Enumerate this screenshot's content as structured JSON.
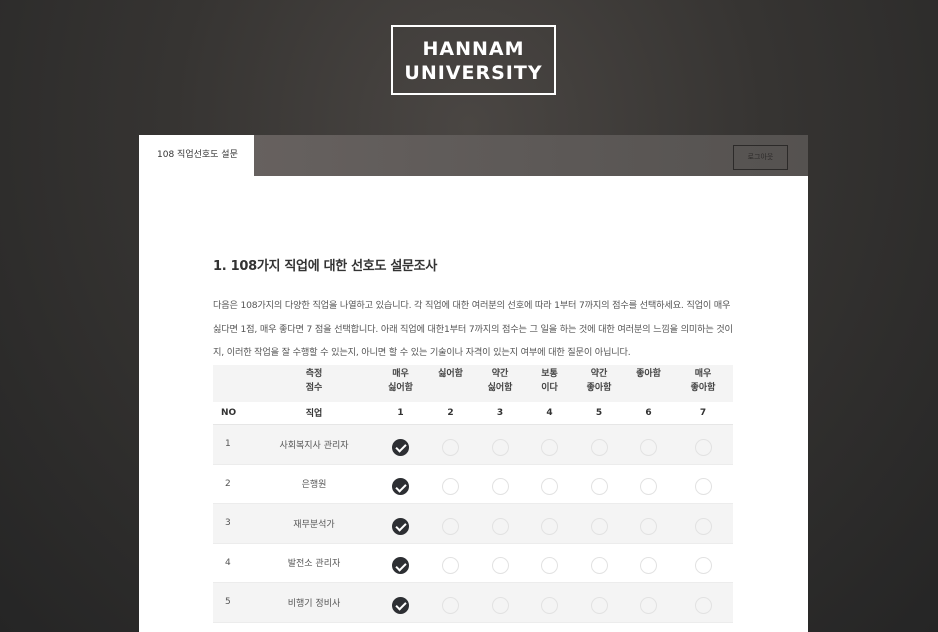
{
  "logo": {
    "line1": "HANNAM",
    "line2": "UNIVERSITY"
  },
  "header": {
    "tab_label": "108 직업선호도 설문",
    "logout_label": "로그아웃"
  },
  "section": {
    "title": "1. 108가지 직업에 대한 선호도 설문조사",
    "description": "다음은 108가지의 다양한 직업을 나열하고 있습니다. 각 직업에 대한 여러분의 선호에 따라 1부터 7까지의 점수를 선택하세요. 직업이 매우 싫다면 1점, 매우 좋다면 7 점을 선택합니다. 아래 직업에 대한1부터 7까지의 점수는 그 일을 하는 것에 대한 여러분의 느낌을 의미하는 것이지, 이러한 작업을 잘 수행할 수 있는지, 아니면 할 수 있는 기술이나 자격이 있는지 여부에 대한 질문이 아닙니다."
  },
  "table": {
    "measure_label": {
      "line1": "측정",
      "line2": "점수"
    },
    "scale_labels": [
      {
        "line1": "매우",
        "line2": "싫어함"
      },
      {
        "line1": "싫어함",
        "line2": ""
      },
      {
        "line1": "약간",
        "line2": "싫어함"
      },
      {
        "line1": "보통",
        "line2": "이다"
      },
      {
        "line1": "약간",
        "line2": "좋아함"
      },
      {
        "line1": "좋아함",
        "line2": ""
      },
      {
        "line1": "매우",
        "line2": "좋아함"
      }
    ],
    "col_no": "NO",
    "col_job": "직업",
    "scores": [
      "1",
      "2",
      "3",
      "4",
      "5",
      "6",
      "7"
    ],
    "rows": [
      {
        "no": "1",
        "job": "사회복지사 관리자",
        "selected": 1
      },
      {
        "no": "2",
        "job": "은행원",
        "selected": 1
      },
      {
        "no": "3",
        "job": "재무분석가",
        "selected": 1
      },
      {
        "no": "4",
        "job": "발전소 관리자",
        "selected": 1
      },
      {
        "no": "5",
        "job": "비행기 정비사",
        "selected": 1
      }
    ]
  }
}
